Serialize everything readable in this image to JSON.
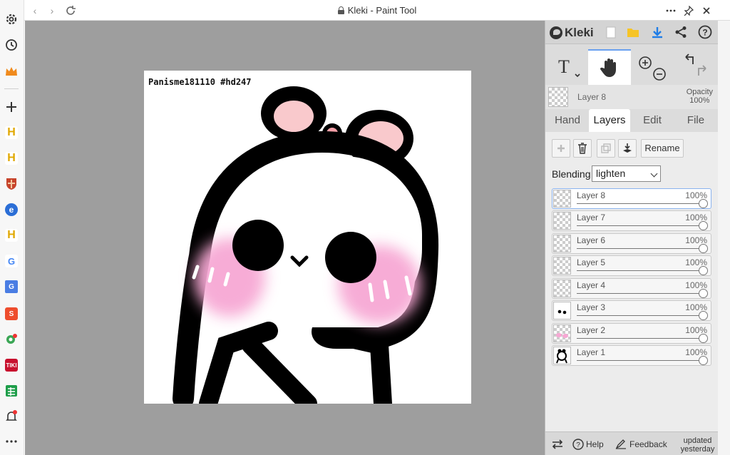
{
  "browser": {
    "title": "Kleki - Paint Tool"
  },
  "canvas": {
    "label": "Panisme181110 #hd247"
  },
  "panel": {
    "brand": "Kleki",
    "layer_info": {
      "name": "Layer 8",
      "opacity_label": "Opacity",
      "opacity_value": "100%"
    },
    "tabs": [
      "Hand",
      "Layers",
      "Edit",
      "File"
    ],
    "active_tab": "Layers",
    "rename_label": "Rename",
    "blending_label": "Blending",
    "blending_value": "lighten",
    "layers": [
      {
        "name": "Layer 8",
        "opacity": "100%",
        "selected": true
      },
      {
        "name": "Layer 7",
        "opacity": "100%"
      },
      {
        "name": "Layer 6",
        "opacity": "100%"
      },
      {
        "name": "Layer 5",
        "opacity": "100%"
      },
      {
        "name": "Layer 4",
        "opacity": "100%"
      },
      {
        "name": "Layer 3",
        "opacity": "100%"
      },
      {
        "name": "Layer 2",
        "opacity": "100%"
      },
      {
        "name": "Layer 1",
        "opacity": "100%"
      }
    ],
    "footer": {
      "help": "Help",
      "feedback": "Feedback",
      "updated_line1": "updated",
      "updated_line2": "yesterday"
    }
  },
  "colors": {
    "accent": "#6aa0ef",
    "canvas_bg": "#9e9e9e",
    "blush": "#f7a8d4",
    "bow": "#f9c9cc"
  }
}
